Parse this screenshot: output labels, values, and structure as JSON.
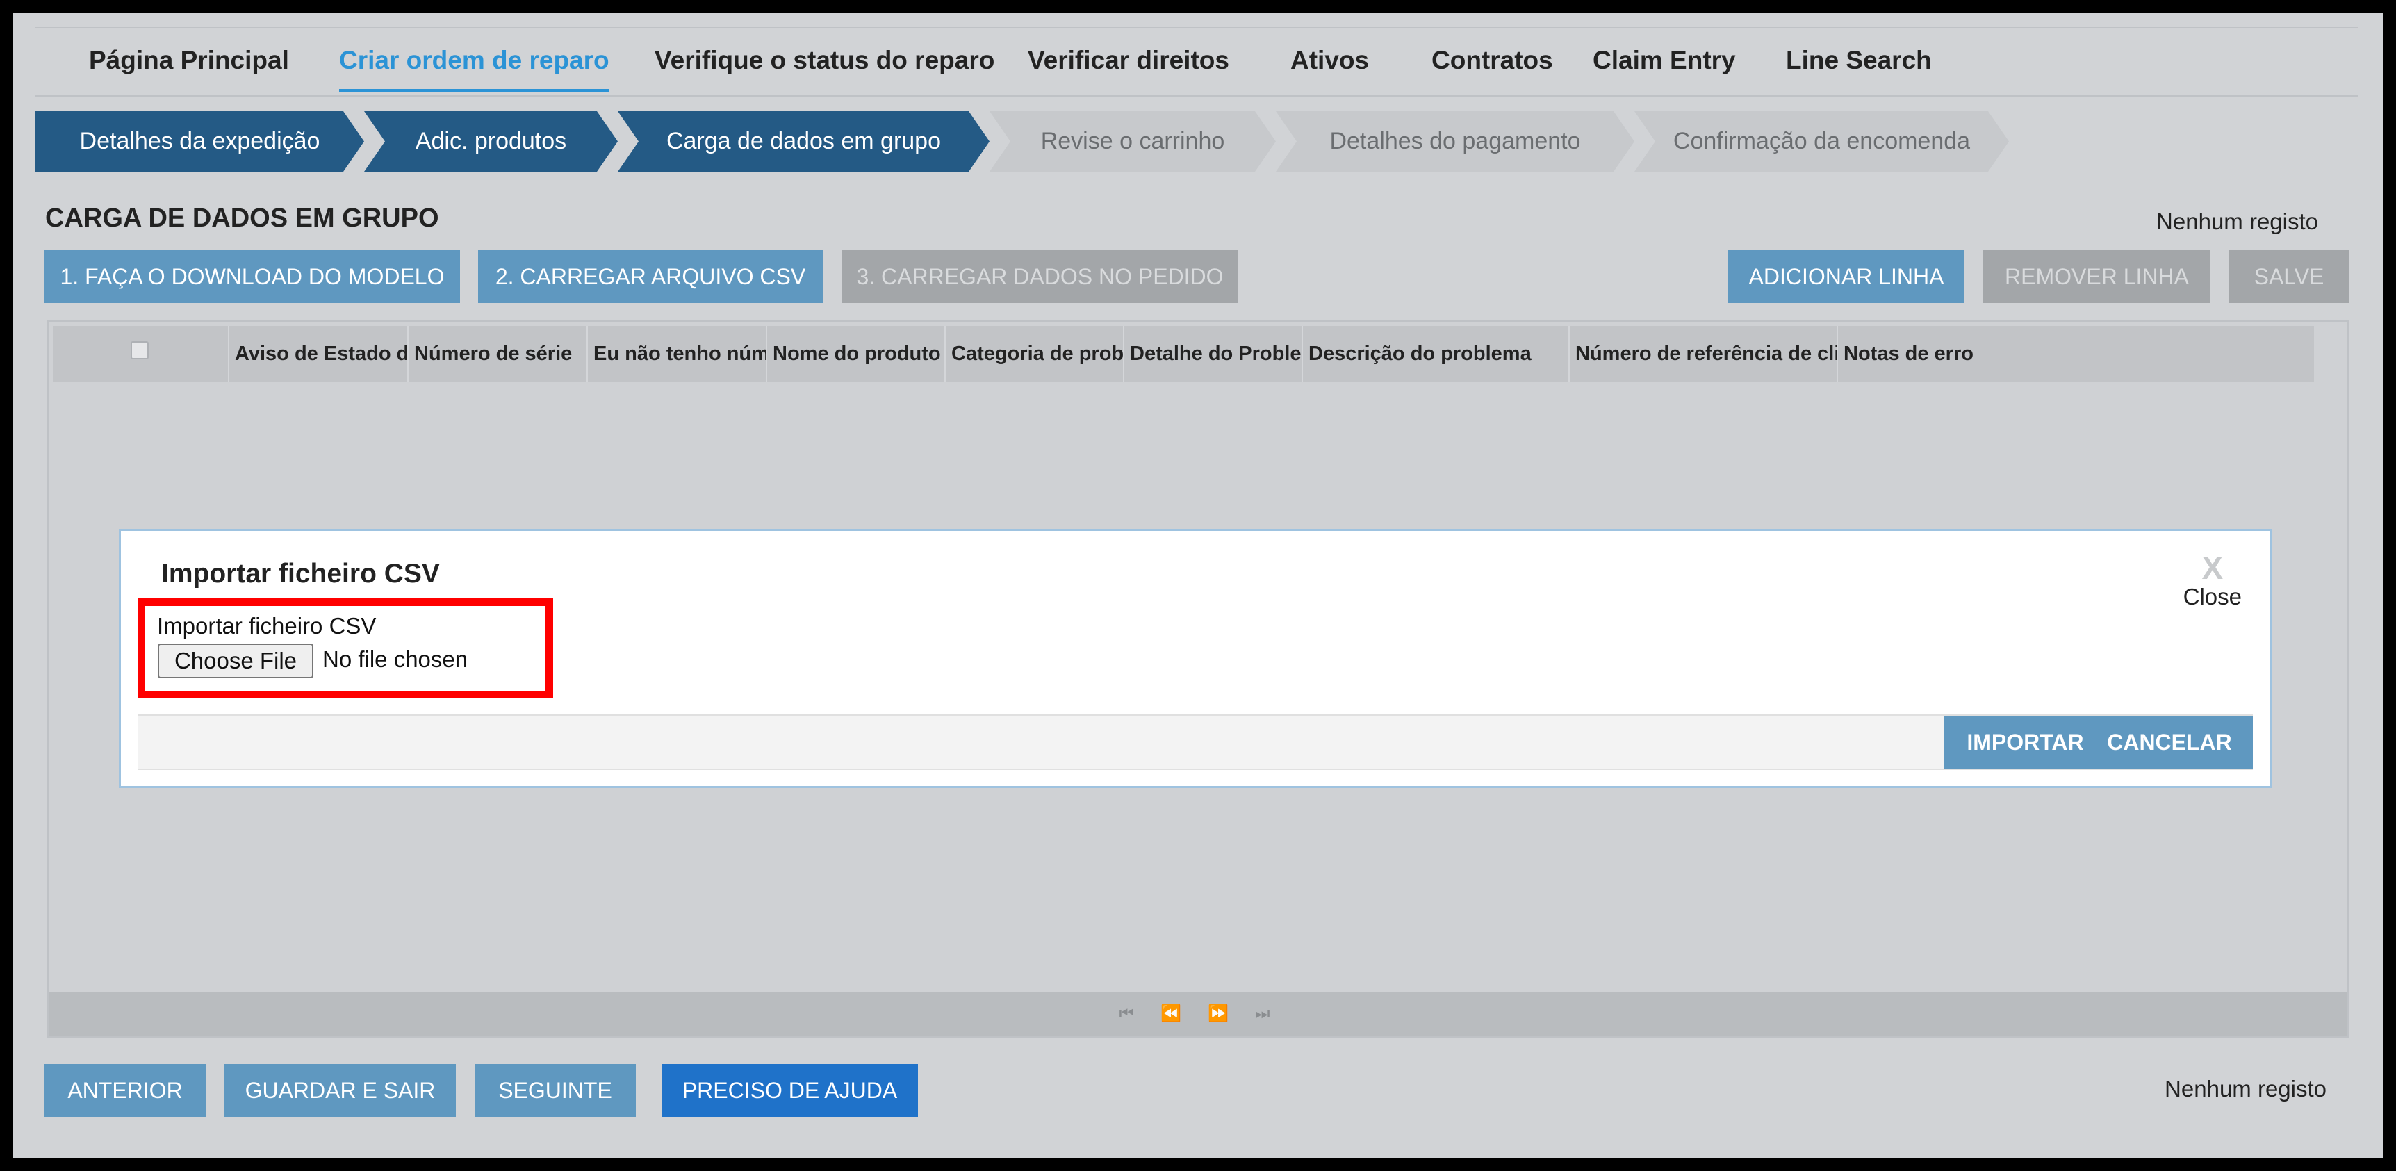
{
  "nav": {
    "items": [
      {
        "label": "Página Principal"
      },
      {
        "label": "Criar ordem de reparo"
      },
      {
        "label": "Verifique o status do reparo"
      },
      {
        "label": "Verificar direitos"
      },
      {
        "label": "Ativos"
      },
      {
        "label": "Contratos"
      },
      {
        "label": "Claim Entry"
      },
      {
        "label": "Line Search"
      }
    ],
    "active": "Criar ordem de reparo"
  },
  "steps": [
    {
      "label": "Detalhes da expedição",
      "state": "done"
    },
    {
      "label": "Adic. produtos",
      "state": "done"
    },
    {
      "label": "Carga de dados em grupo",
      "state": "current"
    },
    {
      "label": "Revise o carrinho",
      "state": "todo"
    },
    {
      "label": "Detalhes do pagamento",
      "state": "todo"
    },
    {
      "label": "Confirmação da encomenda",
      "state": "todo"
    }
  ],
  "page": {
    "title": "CARGA DE DADOS EM GRUPO",
    "records_top": "Nenhum registo",
    "records_bottom": "Nenhum registo"
  },
  "toolbar": {
    "download_template": "1. FAÇA O DOWNLOAD DO MODELO",
    "upload_csv": "2. CARREGAR ARQUIVO CSV",
    "load_data": "3. CARREGAR DADOS NO PEDIDO",
    "add_line": "ADICIONAR LINHA",
    "remove_line": "REMOVER LINHA",
    "save": "SALVE"
  },
  "grid": {
    "columns": [
      "Aviso de Estado d",
      "Número de série",
      "Eu não tenho núm",
      "Nome do produto",
      "Categoria de probl",
      "Detalhe do Probler",
      "Descrição do problema",
      "Número de referência de clie",
      "Notas de erro"
    ]
  },
  "modal": {
    "title": "Importar ficheiro CSV",
    "close_label": "Close",
    "close_glyph": "X",
    "field_label": "Importar ficheiro CSV",
    "choose_file": "Choose File",
    "file_status": "No file chosen",
    "import_label": "IMPORTAR",
    "cancel_label": "CANCELAR"
  },
  "footer": {
    "previous": "ANTERIOR",
    "save_exit": "GUARDAR E SAIR",
    "next": "SEGUINTE",
    "help": "PRECISO DE AJUDA"
  },
  "colors": {
    "active_tab": "#2b93d6",
    "step_done": "#245a85",
    "button_blue": "#5f98c0",
    "button_disabled": "#a3a6a9",
    "help_button": "#1f72c9",
    "highlight_box": "#ff0000"
  }
}
